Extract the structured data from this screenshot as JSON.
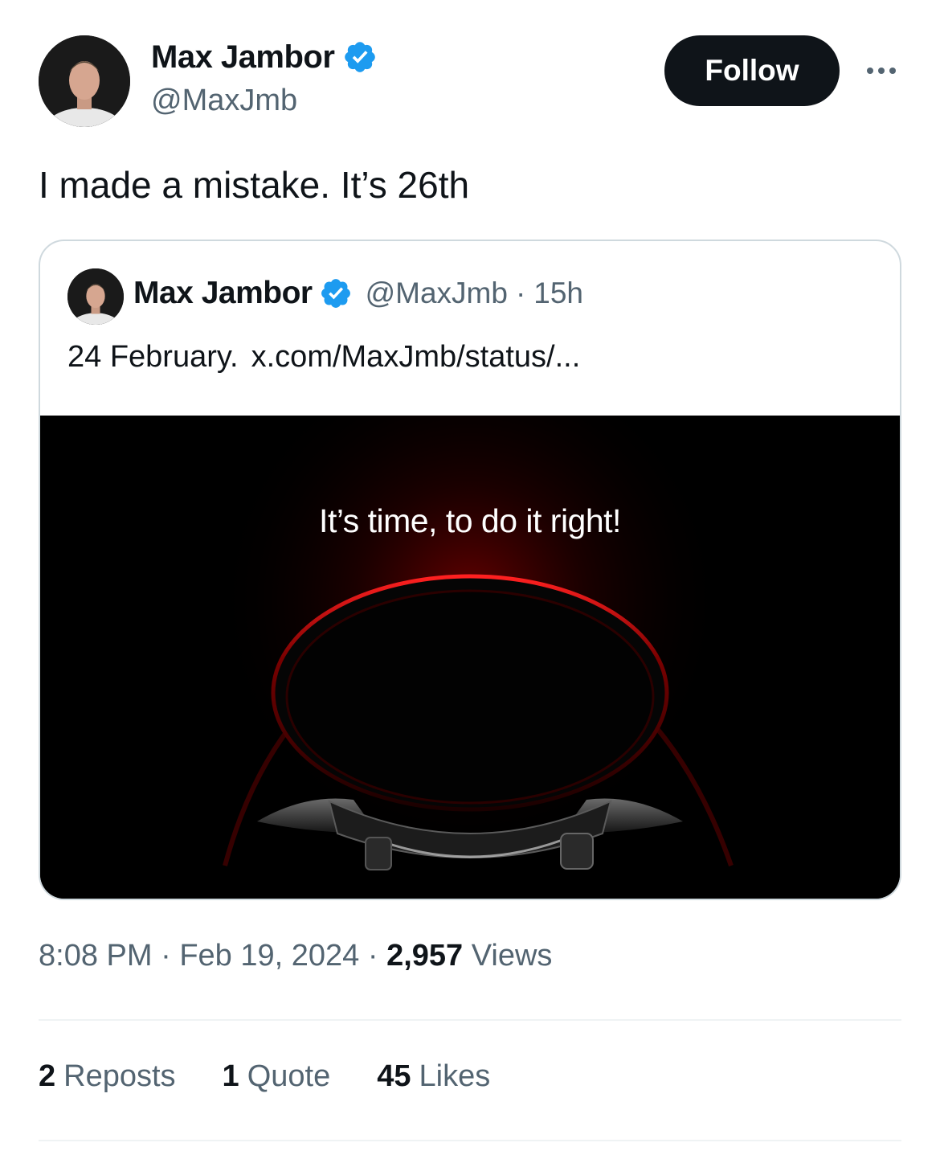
{
  "author": {
    "name": "Max Jambor",
    "handle": "@MaxJmb"
  },
  "actions": {
    "follow_label": "Follow"
  },
  "tweet": {
    "text": "I made a mistake. It’s 26th"
  },
  "quoted_tweet": {
    "name": "Max Jambor",
    "handle": "@MaxJmb",
    "separator": "·",
    "time": "15h",
    "text": "24 February.",
    "link": "x.com/MaxJmb/status/...",
    "media_text": "It’s time, to do it right!"
  },
  "meta": {
    "time": "8:08 PM",
    "separator": "·",
    "date": "Feb 19, 2024",
    "views_count": "2,957",
    "views_label": "Views"
  },
  "stats": {
    "reposts_count": "2",
    "reposts_label": "Reposts",
    "quotes_count": "1",
    "quotes_label": "Quote",
    "likes_count": "45",
    "likes_label": "Likes"
  },
  "colors": {
    "verified": "#1d9bf0",
    "follow_button": "#0f1419",
    "secondary_text": "#536471",
    "glow": "#e00000"
  },
  "icons": [
    "verified-badge-icon",
    "more-options-icon"
  ]
}
